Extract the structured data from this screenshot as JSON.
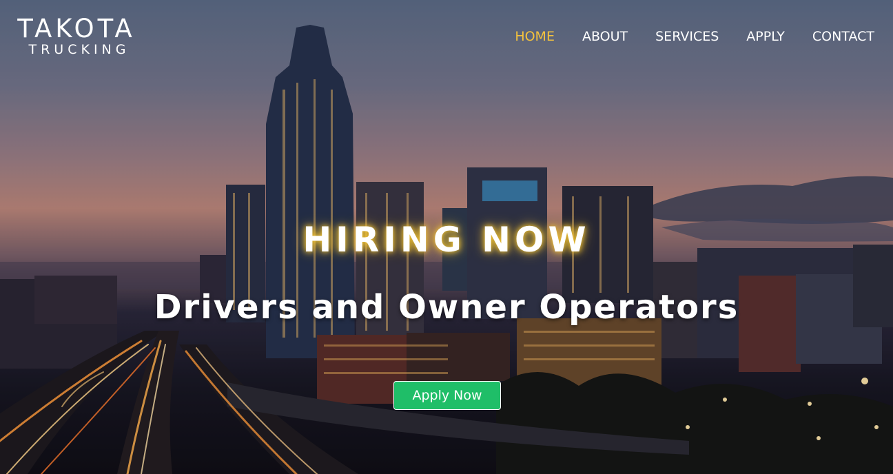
{
  "logo": {
    "main": "TAKOTA",
    "sub": "TRUCKING"
  },
  "nav": {
    "items": [
      {
        "label": "HOME",
        "active": true
      },
      {
        "label": "ABOUT",
        "active": false
      },
      {
        "label": "SERVICES",
        "active": false
      },
      {
        "label": "APPLY",
        "active": false
      },
      {
        "label": "CONTACT",
        "active": false
      }
    ]
  },
  "hero": {
    "headline": "HIRING NOW",
    "subheadline": "Drivers and Owner Operators",
    "cta_label": "Apply Now"
  },
  "colors": {
    "accent": "#f4c23d",
    "cta": "#1fbe68",
    "text": "#ffffff"
  }
}
